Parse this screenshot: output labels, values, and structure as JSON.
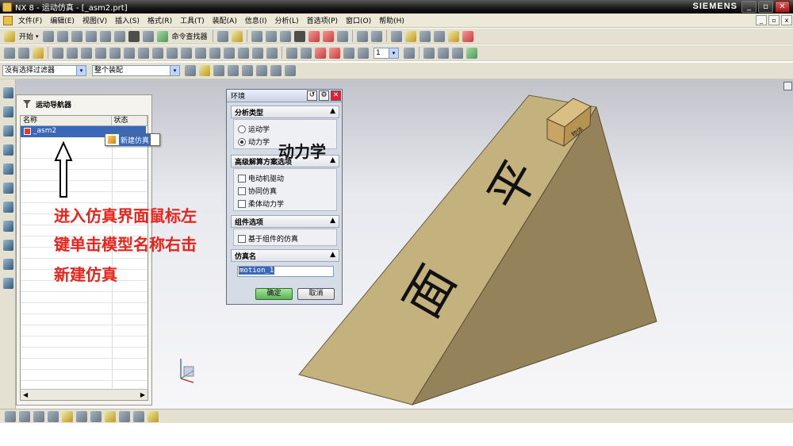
{
  "window": {
    "title": "NX 8 - 运动仿真 - [_asm2.prt]",
    "brand": "SIEMENS"
  },
  "menu": [
    "文件(F)",
    "编辑(E)",
    "视图(V)",
    "插入(S)",
    "格式(R)",
    "工具(T)",
    "装配(A)",
    "信息(I)",
    "分析(L)",
    "首选项(P)",
    "窗口(O)",
    "帮助(H)"
  ],
  "toolbar1": {
    "start": "开始",
    "command_finder": "命令查找器"
  },
  "toolbar2": {
    "frame_value": "1"
  },
  "selection_bar": {
    "filter": "没有选择过滤器",
    "scope": "整个装配"
  },
  "navigator": {
    "title": "运动导航器",
    "columns": [
      "名称",
      "状态"
    ],
    "item": "_asm2"
  },
  "context_menu": {
    "item": "新建仿真"
  },
  "annotation": {
    "lines": [
      "进入仿真界面鼠标左",
      "键单击模型名称右击",
      "新建仿真"
    ],
    "dynamics_callout": "动力学",
    "color": "#e8241c"
  },
  "dialog": {
    "title": "环境",
    "sections": {
      "analysis_type": {
        "label": "分析类型",
        "options": [
          {
            "label": "运动学",
            "selected": false
          },
          {
            "label": "动力学",
            "selected": true
          }
        ]
      },
      "advanced": {
        "label": "高级解算方案选项",
        "options": [
          {
            "label": "电动机驱动",
            "checked": false
          },
          {
            "label": "协同仿真",
            "checked": false
          },
          {
            "label": "柔体动力学",
            "checked": false
          }
        ]
      },
      "component": {
        "label": "组件选项",
        "options": [
          {
            "label": "基于组件的仿真",
            "checked": false
          }
        ]
      },
      "sim_name": {
        "label": "仿真名",
        "value": "motion_1"
      }
    },
    "ok": "确定",
    "cancel": "取消"
  },
  "model": {
    "slope_text": [
      "平",
      "面"
    ],
    "box_label": "物体",
    "colors": {
      "top": "#c2b07c",
      "side": "#938155",
      "text": "#111111"
    }
  }
}
